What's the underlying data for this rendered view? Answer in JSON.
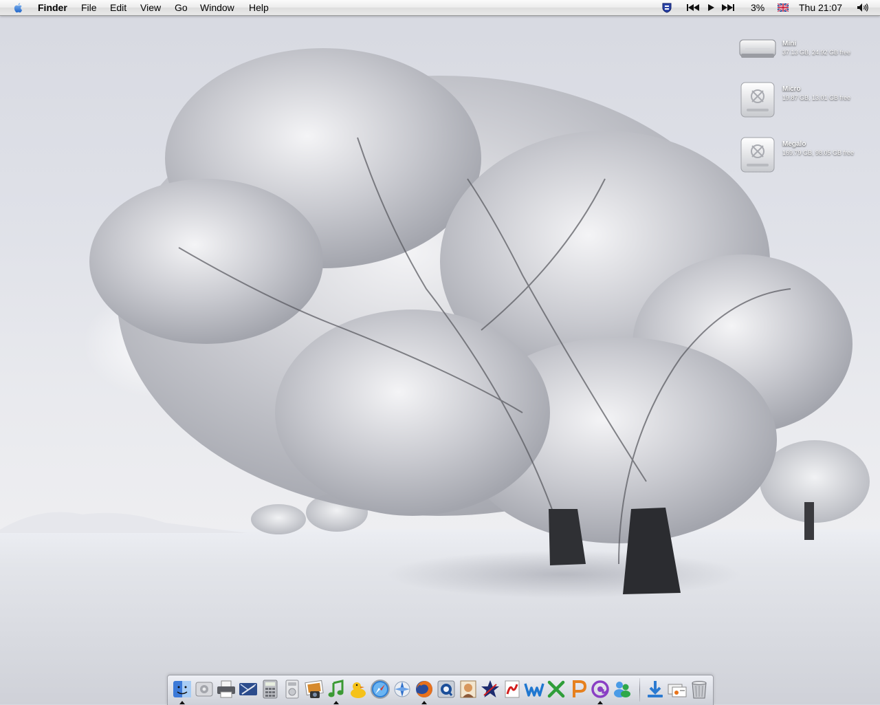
{
  "menubar": {
    "app_name": "Finder",
    "menus": [
      "File",
      "Edit",
      "View",
      "Go",
      "Window",
      "Help"
    ],
    "battery_percent": "3%",
    "clock": "Thu 21:07",
    "extras_icons": [
      "shield-icon",
      "previous-track-icon",
      "play-icon",
      "next-track-icon",
      "uk-flag-icon",
      "volume-icon"
    ]
  },
  "desktop": {
    "wallpaper": "snow-covered-trees",
    "drives": [
      {
        "name": "Mini",
        "info": "37.13 GB, 24.92 GB free",
        "icon": "internal-drive-icon"
      },
      {
        "name": "Micro",
        "info": "19.87 GB, 13.01 GB free",
        "icon": "firewire-drive-icon"
      },
      {
        "name": "Megalo",
        "info": "169.79 GB, 98.05 GB free",
        "icon": "firewire-drive-icon"
      }
    ]
  },
  "dock": {
    "items": [
      {
        "name": "finder-icon",
        "running": true
      },
      {
        "name": "system-preferences-icon",
        "running": false
      },
      {
        "name": "printer-icon",
        "running": false
      },
      {
        "name": "mail-icon",
        "running": false
      },
      {
        "name": "calculator-icon",
        "running": false
      },
      {
        "name": "dvd-player-icon",
        "running": false
      },
      {
        "name": "iphoto-icon",
        "running": false
      },
      {
        "name": "itunes-icon",
        "running": true
      },
      {
        "name": "adium-duck-icon",
        "running": false
      },
      {
        "name": "safari-icon",
        "running": false
      },
      {
        "name": "compass-app-icon",
        "running": false
      },
      {
        "name": "firefox-icon",
        "running": true
      },
      {
        "name": "quicktime-icon",
        "running": false
      },
      {
        "name": "photo-app-icon",
        "running": false
      },
      {
        "name": "star-app-icon",
        "running": false
      },
      {
        "name": "pdf-app-icon",
        "running": false
      },
      {
        "name": "word-icon",
        "running": false
      },
      {
        "name": "excel-icon",
        "running": false
      },
      {
        "name": "powerpoint-icon",
        "running": false
      },
      {
        "name": "entourage-icon",
        "running": true
      },
      {
        "name": "messenger-icon",
        "running": false
      },
      {
        "name": "downloads-stack-icon",
        "running": false
      },
      {
        "name": "documents-stack-icon",
        "running": false
      },
      {
        "name": "trash-icon",
        "running": false
      }
    ]
  }
}
